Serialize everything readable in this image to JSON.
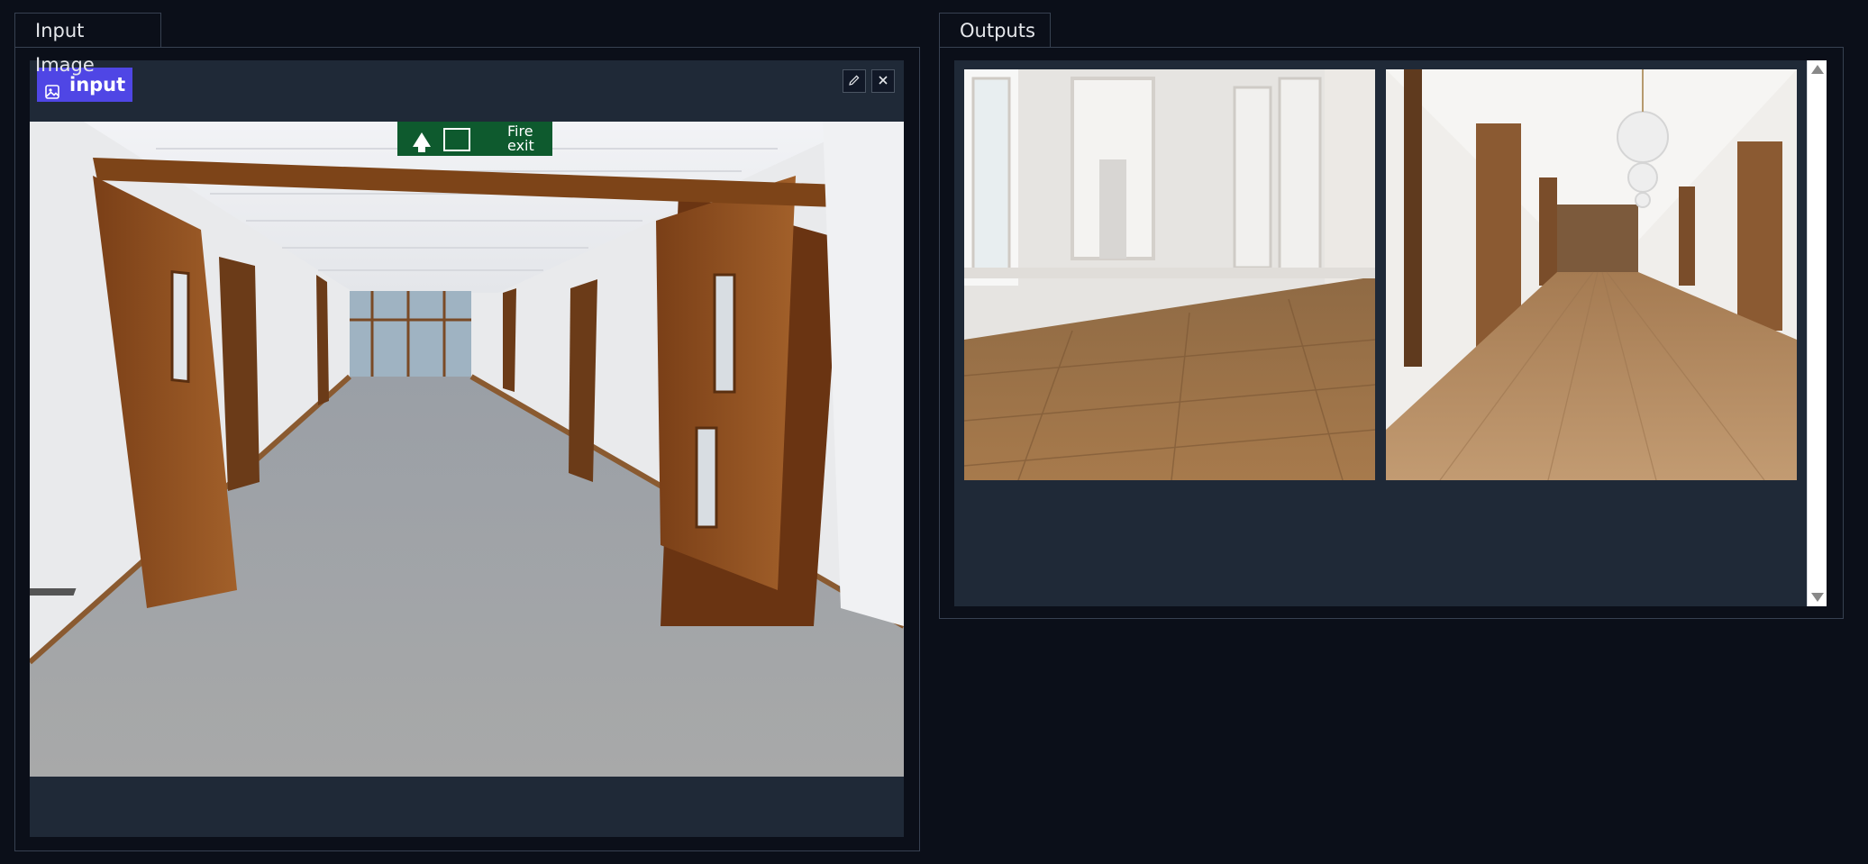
{
  "input_panel": {
    "tab_label": "Input Image",
    "badge_label": "input",
    "badge_icon": "image-icon",
    "edit_icon": "pencil-icon",
    "close_icon": "close-icon"
  },
  "output_panel": {
    "tab_label": "Outputs",
    "images": [
      {
        "name": "output-image-1",
        "scene": "empty-room-wood-floor"
      },
      {
        "name": "output-image-2",
        "scene": "hallway-wood-floor-chandeliers"
      }
    ]
  },
  "input_image": {
    "scene": "office-corridor-fire-exit",
    "sign_text": "Fire\nexit"
  },
  "colors": {
    "background": "#0b0f19",
    "panel_inner": "#1f2937",
    "border": "#374151",
    "badge": "#4f46e5"
  }
}
